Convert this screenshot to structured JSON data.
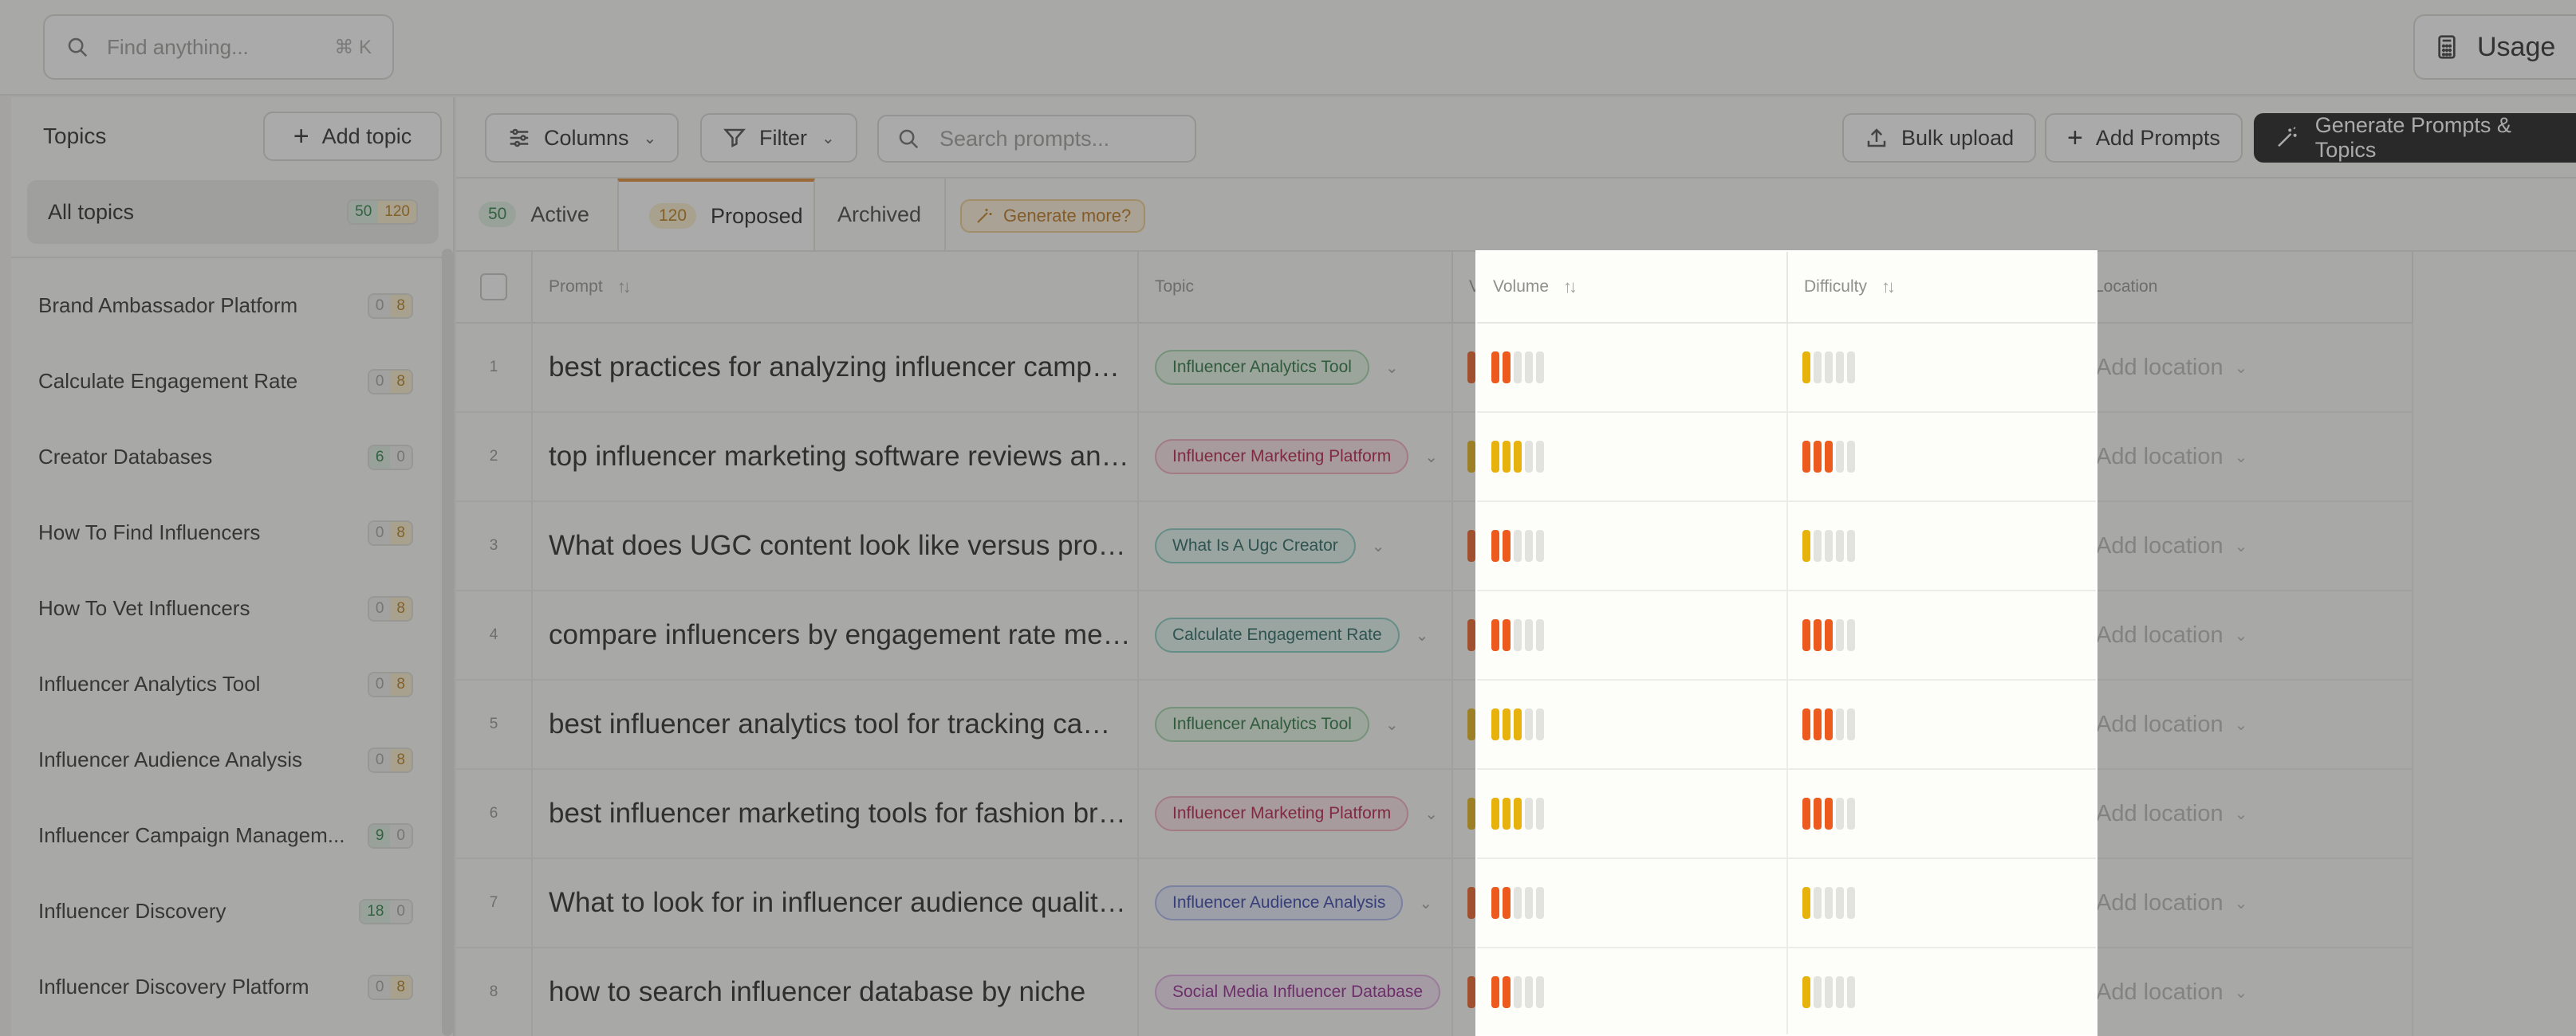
{
  "search": {
    "placeholder": "Find anything...",
    "shortcut": "⌘ K"
  },
  "usage": {
    "label": "Usage"
  },
  "sidebar": {
    "heading": "Topics",
    "add_topic": "Add topic",
    "all": {
      "label": "All topics",
      "active": "50",
      "proposed": "120"
    },
    "items": [
      {
        "label": "Brand Ambassador Platform",
        "a": "0",
        "b": "8"
      },
      {
        "label": "Calculate Engagement Rate",
        "a": "0",
        "b": "8"
      },
      {
        "label": "Creator Databases",
        "a": "6",
        "b": "0"
      },
      {
        "label": "How To Find Influencers",
        "a": "0",
        "b": "8"
      },
      {
        "label": "How To Vet Influencers",
        "a": "0",
        "b": "8"
      },
      {
        "label": "Influencer Analytics Tool",
        "a": "0",
        "b": "8"
      },
      {
        "label": "Influencer Audience Analysis",
        "a": "0",
        "b": "8"
      },
      {
        "label": "Influencer Campaign Managem...",
        "a": "9",
        "b": "0"
      },
      {
        "label": "Influencer Discovery",
        "a": "18",
        "b": "0"
      },
      {
        "label": "Influencer Discovery Platform",
        "a": "0",
        "b": "8"
      }
    ]
  },
  "toolbar": {
    "columns": "Columns",
    "filter": "Filter",
    "search_placeholder": "Search prompts...",
    "bulk_upload": "Bulk upload",
    "add_prompts": "Add Prompts",
    "generate": "Generate Prompts & Topics"
  },
  "tabs": {
    "active": {
      "count": "50",
      "label": "Active"
    },
    "proposed": {
      "count": "120",
      "label": "Proposed"
    },
    "archived": {
      "label": "Archived"
    },
    "generate_more": "Generate more?"
  },
  "table": {
    "headers": {
      "prompt": "Prompt",
      "topic": "Topic",
      "volume": "Volume",
      "difficulty": "Difficulty",
      "location": "Location"
    },
    "location_placeholder": "Add location",
    "rows": [
      {
        "num": "1",
        "prompt": "best practices for analyzing influencer campaign performance",
        "topic": "Influencer Analytics Tool",
        "topic_color": "green",
        "volume": 2,
        "difficulty": 1
      },
      {
        "num": "2",
        "prompt": "top influencer marketing software reviews and ratings",
        "topic": "Influencer Marketing Platform",
        "topic_color": "red",
        "volume": 3,
        "difficulty": 3
      },
      {
        "num": "3",
        "prompt": "What does UGC content look like versus professional content",
        "topic": "What Is A Ugc Creator",
        "topic_color": "teal",
        "volume": 2,
        "difficulty": 1
      },
      {
        "num": "4",
        "prompt": "compare influencers by engagement rate metrics",
        "topic": "Calculate Engagement Rate",
        "topic_color": "teal",
        "volume": 2,
        "difficulty": 3
      },
      {
        "num": "5",
        "prompt": "best influencer analytics tool for tracking campaign ROI",
        "topic": "Influencer Analytics Tool",
        "topic_color": "green",
        "volume": 3,
        "difficulty": 3
      },
      {
        "num": "6",
        "prompt": "best influencer marketing tools for fashion brands",
        "topic": "Influencer Marketing Platform",
        "topic_color": "red",
        "volume": 3,
        "difficulty": 3
      },
      {
        "num": "7",
        "prompt": "What to look for in influencer audience quality analysis",
        "topic": "Influencer Audience Analysis",
        "topic_color": "blue",
        "volume": 2,
        "difficulty": 1
      },
      {
        "num": "8",
        "prompt": "how to search influencer database by niche",
        "topic": "Social Media Influencer Database",
        "topic_color": "purple",
        "volume": 2,
        "difficulty": 1
      }
    ]
  },
  "colors": {
    "bar_orange": "#ec5a1d",
    "bar_yellow": "#e8b20c",
    "bar_empty": "#e2e2de",
    "accent_dark": "#111111",
    "tab_accent": "#e08a2e"
  },
  "pill_styles": {
    "green": {
      "bg": "#e4f5e6",
      "border": "#9dd3a6",
      "fg": "#1e6e35"
    },
    "red": {
      "bg": "#fbe3e8",
      "border": "#f1a9b8",
      "fg": "#b3123c"
    },
    "teal": {
      "bg": "#e2f5f1",
      "border": "#7fcbbd",
      "fg": "#1c5f55"
    },
    "blue": {
      "bg": "#e6e9fb",
      "border": "#a9b3ee",
      "fg": "#2c3aa6"
    },
    "purple": {
      "bg": "#f6e4f6",
      "border": "#e1a9df",
      "fg": "#8e1b8a"
    }
  }
}
